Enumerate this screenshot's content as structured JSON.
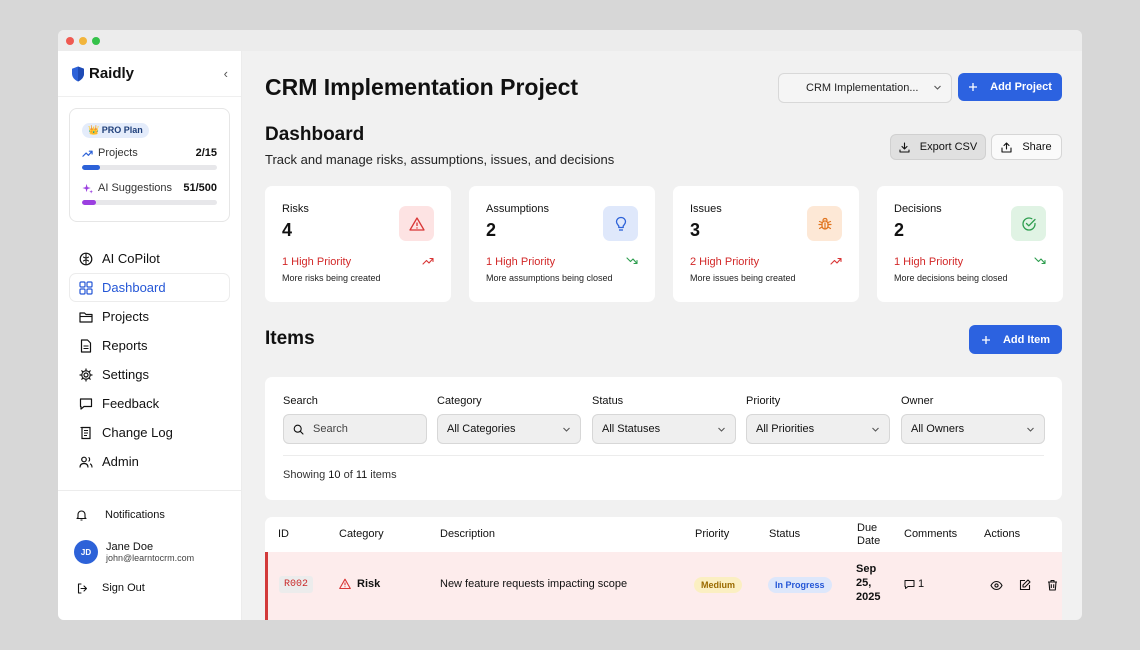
{
  "app": {
    "name": "Raidly"
  },
  "window": {
    "dots": [
      "#ef5a52",
      "#f2b53c",
      "#35c24a"
    ]
  },
  "sidebar": {
    "collapse": "‹",
    "plan": {
      "badge": "👑 PRO Plan",
      "projects_label": "Projects",
      "projects_value": "2/15",
      "projects_fraction": 0.1333,
      "ai_label": "AI Suggestions",
      "ai_value": "51/500",
      "ai_fraction": 0.102
    },
    "items": [
      {
        "label": "AI CoPilot",
        "icon": "brain-icon"
      },
      {
        "label": "Dashboard",
        "icon": "grid-icon",
        "active": true
      },
      {
        "label": "Projects",
        "icon": "folder-icon"
      },
      {
        "label": "Reports",
        "icon": "document-icon"
      },
      {
        "label": "Settings",
        "icon": "gear-icon"
      },
      {
        "label": "Feedback",
        "icon": "message-icon"
      },
      {
        "label": "Change Log",
        "icon": "scroll-icon"
      },
      {
        "label": "Admin",
        "icon": "users-icon"
      }
    ],
    "notifications": "Notifications",
    "user": {
      "initials": "JD",
      "name": "Jane Doe",
      "email": "john@learntocrm.com"
    },
    "sign_out": "Sign Out"
  },
  "header": {
    "title": "CRM Implementation Project",
    "project_select": "CRM Implementation...",
    "add_project": "Add Project"
  },
  "dashboard": {
    "title": "Dashboard",
    "subtitle": "Track and manage risks, assumptions, issues, and decisions",
    "export": "Export CSV",
    "share": "Share"
  },
  "stats": [
    {
      "title": "Risks",
      "count": "4",
      "priority": "1 High Priority",
      "desc": "More risks being created",
      "icon": "warning-icon",
      "color": "#d93636",
      "bg": "#fde3e3",
      "trend": "up",
      "trend_color": "#d93636"
    },
    {
      "title": "Assumptions",
      "count": "2",
      "priority": "1 High Priority",
      "desc": "More assumptions being closed",
      "icon": "lightbulb-icon",
      "color": "#2d62d8",
      "bg": "#dfe8fb",
      "trend": "down",
      "trend_color": "#2e9e4f"
    },
    {
      "title": "Issues",
      "count": "3",
      "priority": "2 High Priority",
      "desc": "More issues being created",
      "icon": "bug-icon",
      "color": "#e0741f",
      "bg": "#fde8d6",
      "trend": "up",
      "trend_color": "#d93636"
    },
    {
      "title": "Decisions",
      "count": "2",
      "priority": "1 High Priority",
      "desc": "More decisions being closed",
      "icon": "check-circle-icon",
      "color": "#2e9e4f",
      "bg": "#e0f3e4",
      "trend": "down",
      "trend_color": "#2e9e4f"
    }
  ],
  "items": {
    "title": "Items",
    "add_item": "Add Item"
  },
  "filters": {
    "search_label": "Search",
    "search_placeholder": "Search",
    "category_label": "Category",
    "category_value": "All Categories",
    "status_label": "Status",
    "status_value": "All Statuses",
    "priority_label": "Priority",
    "priority_value": "All Priorities",
    "owner_label": "Owner",
    "owner_value": "All Owners",
    "showing_prefix": "Showing ",
    "showing_count": "10",
    "showing_of": " of ",
    "showing_total": "11",
    "showing_suffix": " items"
  },
  "table": {
    "headers": [
      "ID",
      "Category",
      "Description",
      "Priority",
      "Status",
      "Due Date",
      "Comments",
      "Actions"
    ],
    "rows": [
      {
        "id": "R002",
        "category": "Risk",
        "description": "New feature requests impacting scope",
        "priority": "Medium",
        "status": "In Progress",
        "due_date": "Sep 25, 2025",
        "comments": "1"
      }
    ]
  }
}
